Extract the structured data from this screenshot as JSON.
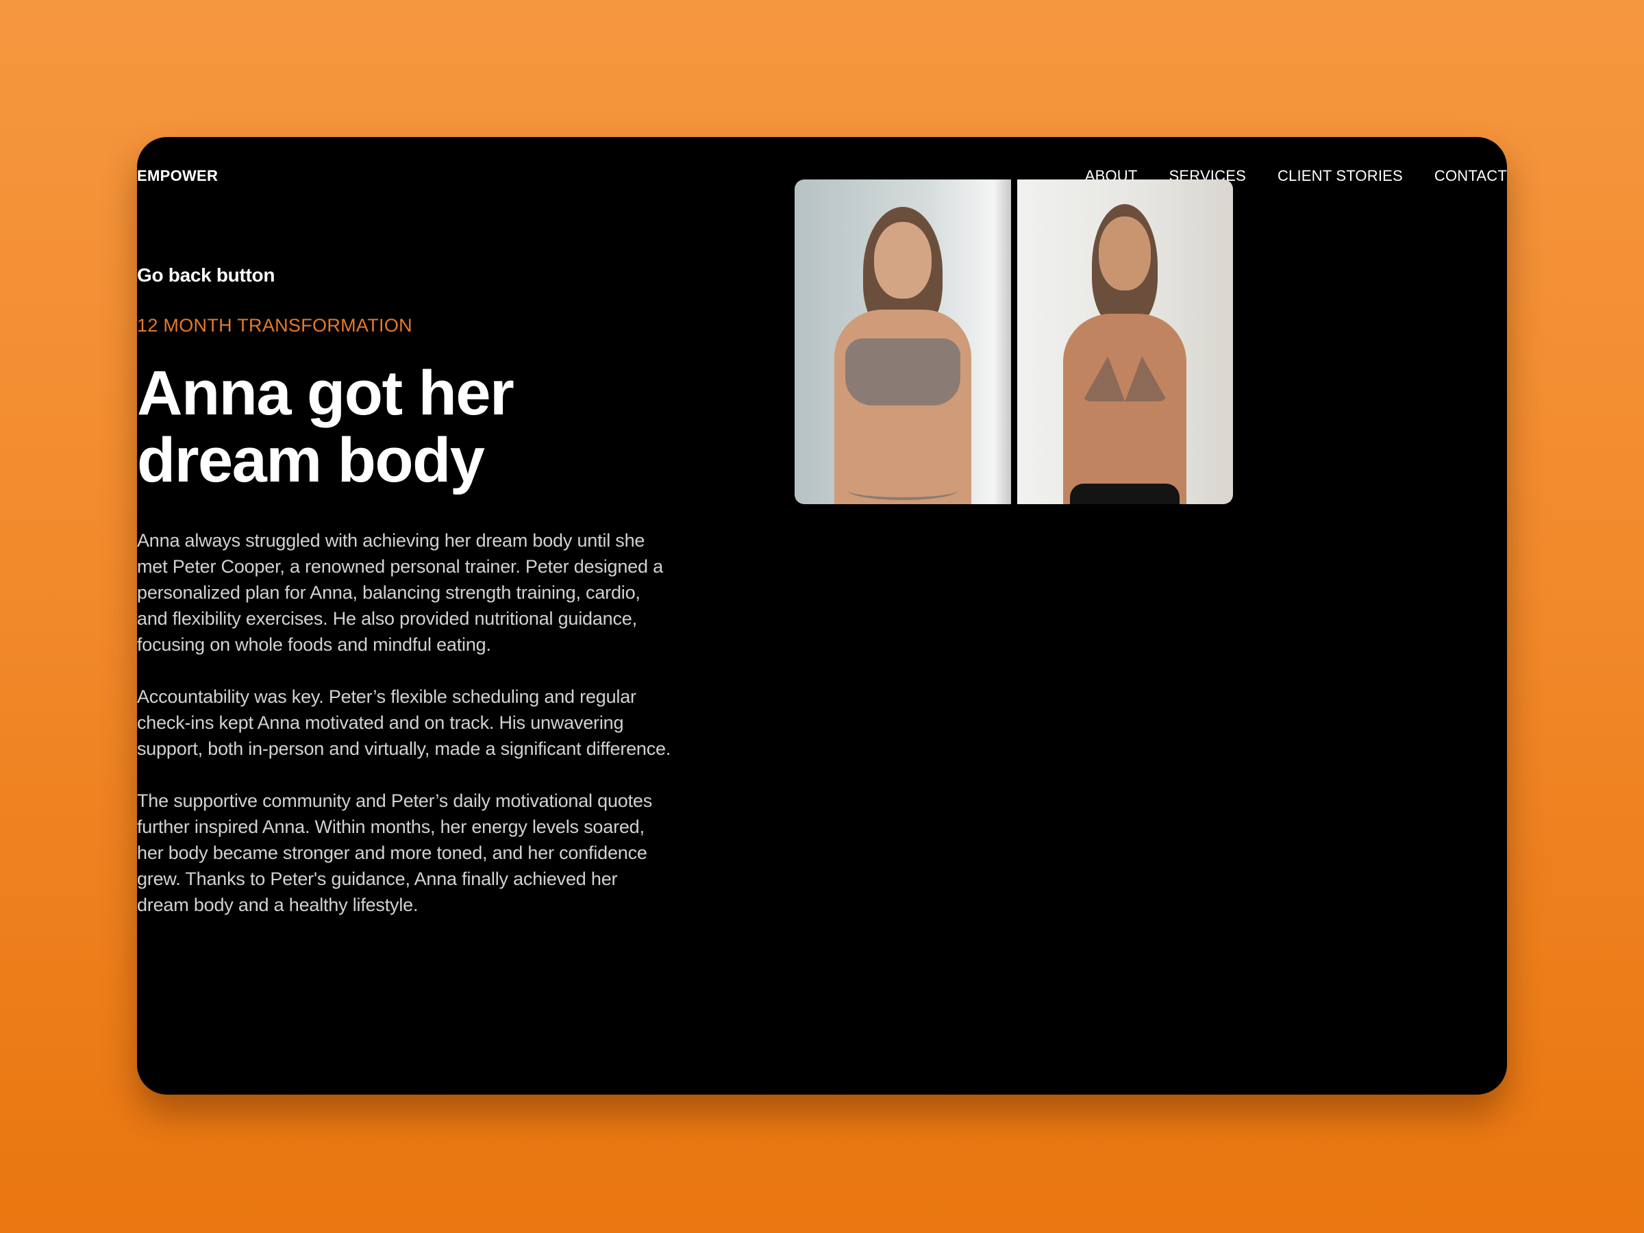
{
  "header": {
    "brand": "EMPOWER",
    "nav": [
      "ABOUT",
      "SERVICES",
      "CLIENT STORIES",
      "CONTACT"
    ]
  },
  "story": {
    "back_label": "Go back button",
    "eyebrow": "12 MONTH TRANSFORMATION",
    "title_line1": "Anna got her",
    "title_line2": "dream body",
    "paragraphs": [
      "Anna always struggled with achieving her dream body until she met Peter Cooper, a renowned personal trainer. Peter designed a personalized plan for Anna, balancing strength training, cardio, and flexibility exercises. He also provided nutritional guidance, focusing on whole foods and mindful eating.",
      "Accountability was key. Peter’s flexible scheduling and regular check-ins kept Anna motivated and on track. His unwavering support, both in-person and virtually, made a significant difference.",
      "The supportive community and Peter’s daily motivational quotes further inspired Anna. Within months, her energy levels soared, her body became stronger and more toned, and her confidence grew. Thanks to Peter's guidance, Anna finally achieved her dream body and a healthy lifestyle."
    ]
  },
  "media": {
    "before_alt": "before-photo",
    "after_alt": "after-photo"
  },
  "colors": {
    "accent": "#e67a26",
    "background": "#f28a2c",
    "card": "#000000"
  }
}
